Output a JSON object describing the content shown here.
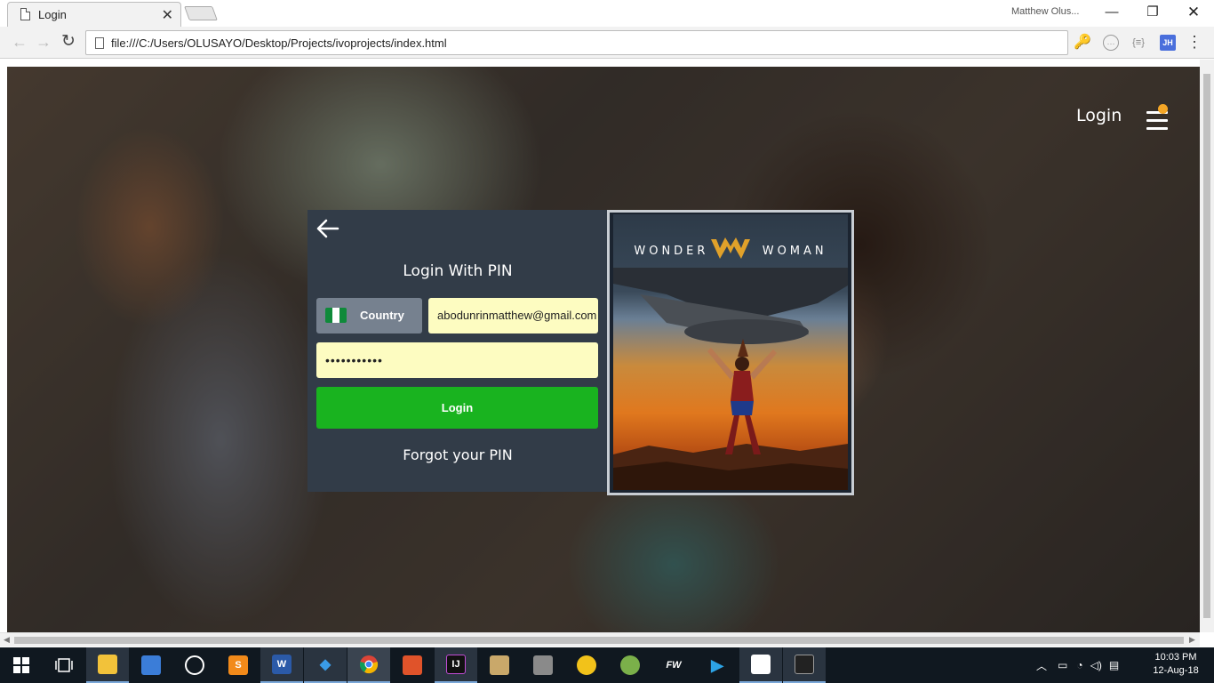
{
  "browser": {
    "tab_title": "Login",
    "tab_close": "✕",
    "user_name": "Matthew Olus...",
    "url": "file:///C:/Users/OLUSAYO/Desktop/Projects/ivoprojects/index.html",
    "back_glyph": "←",
    "forward_glyph": "→",
    "reload_glyph": "↻",
    "min_glyph": "—",
    "max_glyph": "❐",
    "close_glyph": "✕",
    "extensions": [
      {
        "name": "key-icon",
        "glyph": "🔑"
      },
      {
        "name": "circle-extension-icon",
        "glyph": "⋯"
      },
      {
        "name": "braces-extension-icon",
        "glyph": "{≡}"
      },
      {
        "name": "jh-extension-icon",
        "glyph": "JH"
      }
    ],
    "menu_glyph": "⋮"
  },
  "page": {
    "nav_login": "Login",
    "notification_color": "#f4a626",
    "panel": {
      "title": "Login With PIN",
      "country_label": "Country",
      "flag_colors": [
        "#0f8a3a",
        "#ffffff",
        "#0f8a3a"
      ],
      "email_value": "abodunrinmatthew@gmail.com",
      "pin_value": "•••••••••••",
      "login_button": "Login",
      "forgot_link": "Forgot your PIN",
      "panel_color": "#323c48",
      "button_color": "#19b31f",
      "input_color": "#fdfcc1"
    },
    "poster": {
      "title_left": "WONDER",
      "title_right": "WOMAN"
    }
  },
  "taskbar": {
    "apps": [
      {
        "name": "start-button-icon",
        "label": ""
      },
      {
        "name": "task-view-icon",
        "label": ""
      },
      {
        "name": "file-explorer-icon",
        "label": ""
      },
      {
        "name": "control-panel-icon",
        "label": ""
      },
      {
        "name": "obs-icon",
        "label": ""
      },
      {
        "name": "sublime-text-icon",
        "label": "S"
      },
      {
        "name": "word-icon",
        "label": "W"
      },
      {
        "name": "vscode-icon",
        "label": "◆"
      },
      {
        "name": "chrome-icon",
        "label": ""
      },
      {
        "name": "sourcetree-icon",
        "label": ""
      },
      {
        "name": "intellij-icon",
        "label": "IJ"
      },
      {
        "name": "paint-icon",
        "label": ""
      },
      {
        "name": "gimp-icon",
        "label": ""
      },
      {
        "name": "xampp-icon",
        "label": ""
      },
      {
        "name": "android-studio-icon",
        "label": ""
      },
      {
        "name": "fw-icon",
        "label": "FW"
      },
      {
        "name": "media-player-icon",
        "label": "▶"
      },
      {
        "name": "photos-icon",
        "label": ""
      },
      {
        "name": "terminal-icon",
        "label": ""
      }
    ],
    "time": "10:03 PM",
    "date": "12-Aug-18"
  }
}
